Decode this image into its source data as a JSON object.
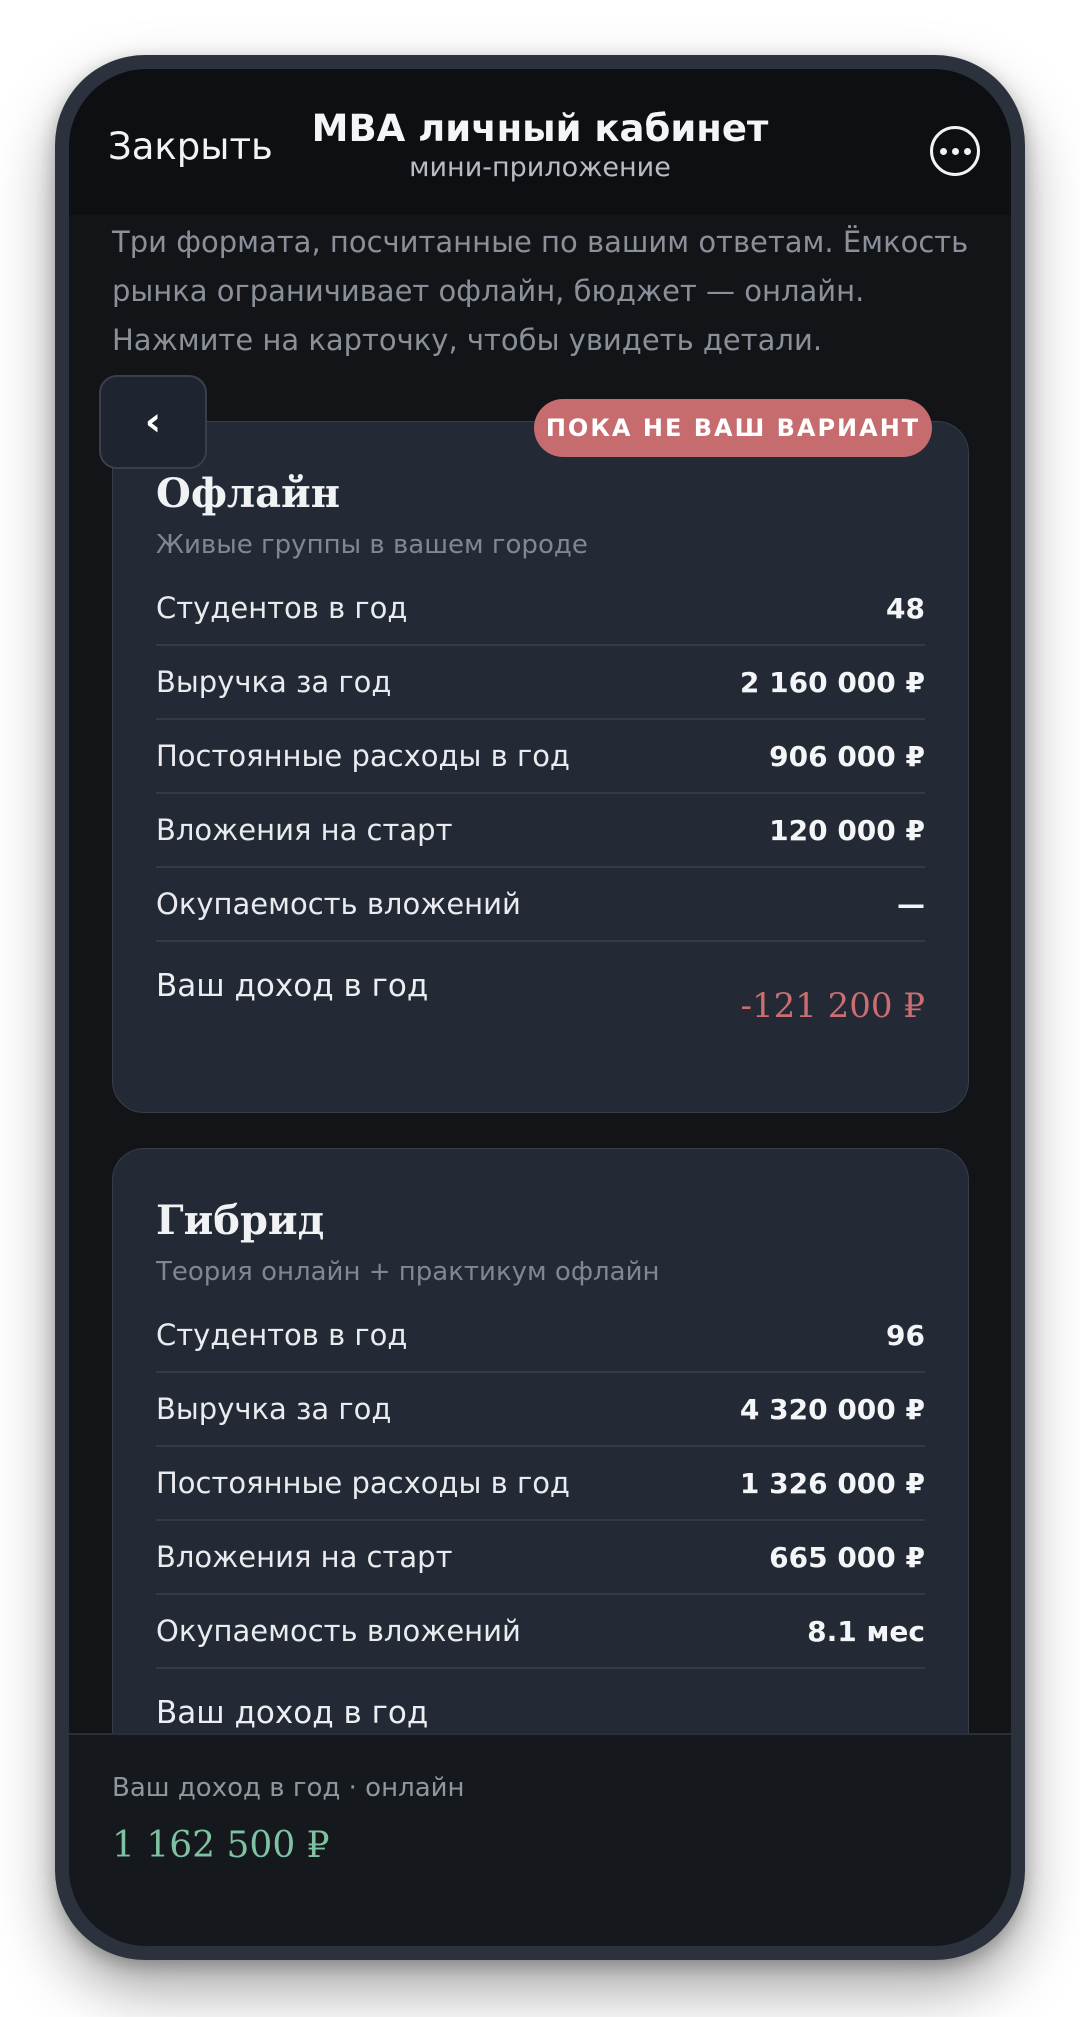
{
  "header": {
    "close_label": "Закрыть",
    "title": "MBA личный кабинет",
    "subtitle": "мини-приложение",
    "more_icon": "more-horizontal-circle-icon"
  },
  "intro": "Три формата, посчитанные по вашим ответам. Ёмкость рынка ограничивает офлайн, бюджет — онлайн. Нажмите на карточку, чтобы увидеть детали.",
  "back_icon": "chevron-left-icon",
  "cards": [
    {
      "badge": "ПОКА НЕ ВАШ ВАРИАНТ",
      "title": "Офлайн",
      "subtitle": "Живые группы в вашем городе",
      "rows": [
        {
          "label": "Студентов в год",
          "value": "48"
        },
        {
          "label": "Выручка за год",
          "value": "2 160 000 ₽"
        },
        {
          "label": "Постоянные расходы в год",
          "value": "906 000 ₽"
        },
        {
          "label": "Вложения на старт",
          "value": "120 000 ₽"
        },
        {
          "label": "Окупаемость вложений",
          "value": "—"
        }
      ],
      "income_label": "Ваш доход в год",
      "income_value": "-121 200 ₽"
    },
    {
      "title": "Гибрид",
      "subtitle": "Теория онлайн + практикум офлайн",
      "rows": [
        {
          "label": "Студентов в год",
          "value": "96"
        },
        {
          "label": "Выручка за год",
          "value": "4 320 000 ₽"
        },
        {
          "label": "Постоянные расходы в год",
          "value": "1 326 000 ₽"
        },
        {
          "label": "Вложения на старт",
          "value": "665 000 ₽"
        },
        {
          "label": "Окупаемость вложений",
          "value": "8.1 мес"
        }
      ],
      "income_label": "Ваш доход в год"
    }
  ],
  "footer": {
    "label": "Ваш доход в год · онлайн",
    "value": "1 162 500 ₽"
  },
  "colors": {
    "negative": "#cc6e71",
    "positive": "#7fc1a3",
    "badge": "#c66b6e"
  }
}
